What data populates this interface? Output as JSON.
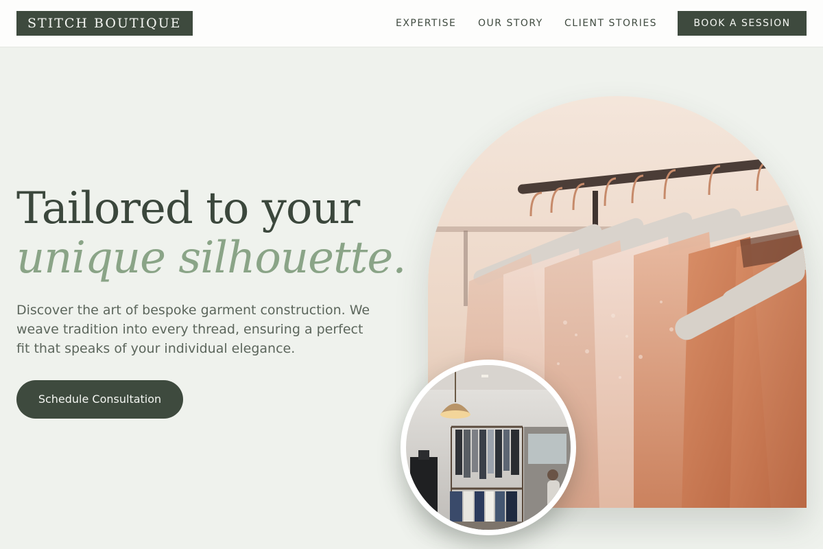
{
  "brand": {
    "name": "STITCH BOUTIQUE"
  },
  "nav": {
    "items": [
      {
        "label": "EXPERTISE"
      },
      {
        "label": "OUR STORY"
      },
      {
        "label": "CLIENT STORIES"
      }
    ],
    "cta_label": "BOOK A SESSION"
  },
  "hero": {
    "headline_line1": "Tailored to your",
    "headline_line2": "unique silhouette.",
    "description": "Discover the art of bespoke garment construction. We weave tradition into every thread, ensuring a perfect fit that speaks of your individual elegance.",
    "cta_label": "Schedule Consultation"
  },
  "images": {
    "main": {
      "icon": "garment-rack-photo"
    },
    "inset": {
      "icon": "boutique-interior-photo"
    }
  },
  "colors": {
    "page_background": "#eff2ed",
    "header_background": "#fdfdfc",
    "primary_dark": "#3e4a3e",
    "accent_sage": "#8aa487",
    "body_text": "#5c665c"
  }
}
